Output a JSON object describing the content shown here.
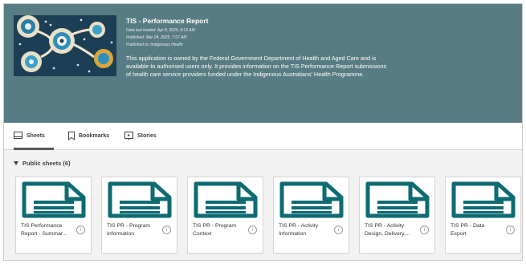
{
  "app": {
    "title": "TIS - Performance Report",
    "data_last_loaded": "Data last loaded: Apr 8, 2025, 8:19 AM",
    "published": "Published: Mar 24, 2025, 7:57 AM",
    "published_to": "Published to: Indigenous Health",
    "description": "This application is owned by the Federal Government Department of Health and Aged Care and is available to authorised users only. It provides information on the TIS Performance Report submissions of health care service providers funded under the Indigenous Australians' Health Programme.",
    "thumbnail_icon": "aboriginal-art-thumbnail",
    "header_color": "#587c83",
    "accent_color": "#0d6b72"
  },
  "tabs": [
    {
      "label": "Sheets",
      "icon": "sheets-icon",
      "active": true
    },
    {
      "label": "Bookmarks",
      "icon": "bookmark-icon",
      "active": false
    },
    {
      "label": "Stories",
      "icon": "stories-icon",
      "active": false
    }
  ],
  "section": {
    "label": "Public sheets (6)"
  },
  "sheets": [
    {
      "line1": "TIS Performance",
      "line2": "Report - Summar..."
    },
    {
      "line1": "TIS PR - Program",
      "line2": "Information"
    },
    {
      "line1": "TIS PR - Program",
      "line2": "Context"
    },
    {
      "line1": "TIS PR - Activity",
      "line2": "Information"
    },
    {
      "line1": "TIS PR - Activity",
      "line2": "Design, Delivery,..."
    },
    {
      "line1": "TIS PR - Data",
      "line2": "Export"
    }
  ],
  "info_glyph": "i"
}
